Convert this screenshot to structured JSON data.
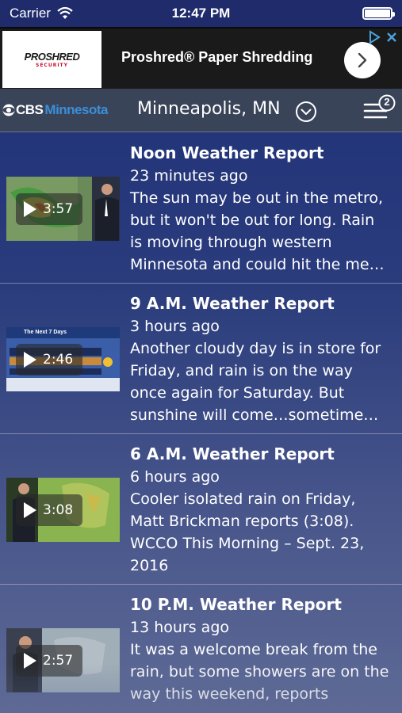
{
  "status_bar": {
    "carrier": "Carrier",
    "time": "12:47 PM"
  },
  "ad": {
    "logo_main": "PROSHRED",
    "logo_sub": "SECURITY",
    "title": "Proshred® Paper Shredding"
  },
  "header": {
    "brand_cbs": "CBS",
    "brand_city": "Minnesota",
    "location": "Minneapolis, MN",
    "menu_badge": "2"
  },
  "feed": [
    {
      "title": "Noon Weather Report",
      "ago": "23 minutes ago",
      "summary": "The sun may be out in the metro, but it won't be out for long. Rain is moving through western Minnesota and could hit the me…",
      "duration": "3:57"
    },
    {
      "title": "9 A.M. Weather Report",
      "ago": "3 hours ago",
      "summary": "Another cloudy day is in store for Friday, and rain is on the way once again for Saturday. But sunshine will come…sometime…",
      "duration": "2:46",
      "thumb_caption": "The Next 7 Days"
    },
    {
      "title": "6 A.M. Weather Report",
      "ago": "6 hours ago",
      "summary": "Cooler isolated rain on Friday, Matt Brickman reports (3:08). WCCO This Morning – Sept. 23, 2016",
      "duration": "3:08"
    },
    {
      "title": "10 P.M. Weather Report",
      "ago": "13 hours ago",
      "summary": "It was a welcome break from the rain, but some showers are on the way this weekend, reports",
      "duration": "2:57"
    }
  ]
}
